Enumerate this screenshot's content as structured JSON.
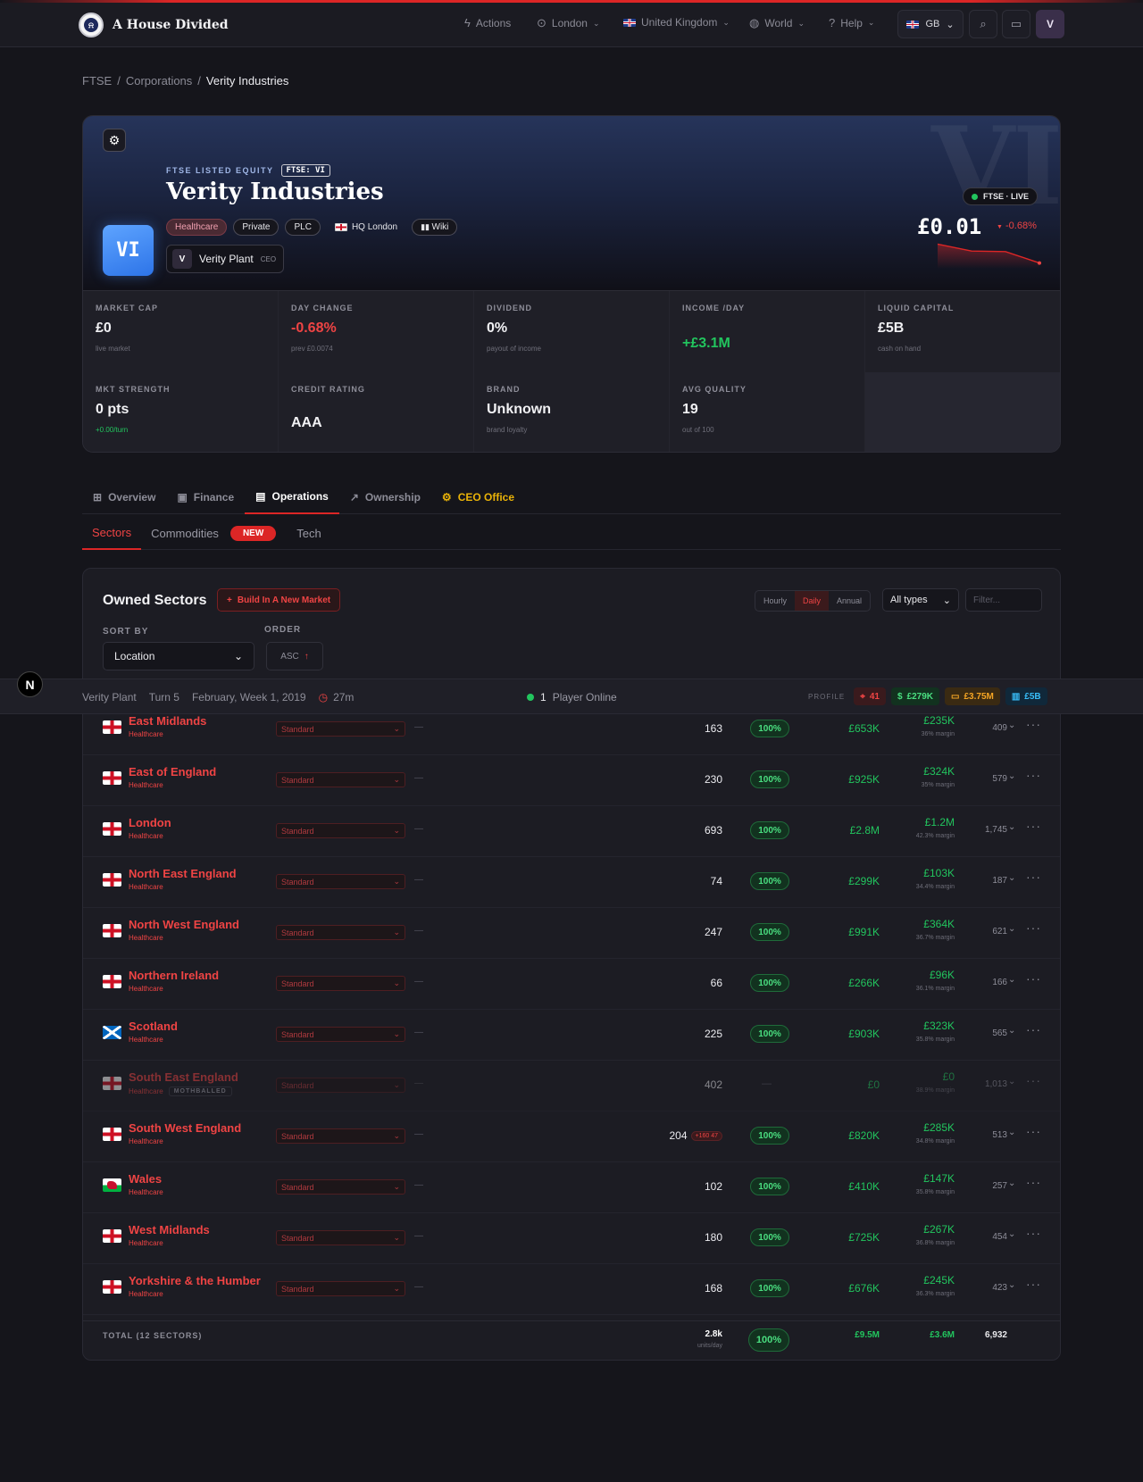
{
  "brand": {
    "name": "A House Divided"
  },
  "nav": {
    "actions": "Actions",
    "city": "London",
    "country": "United Kingdom",
    "world": "World",
    "help": "Help",
    "region": "GB",
    "avatar": "V"
  },
  "breadcrumb": {
    "root": "FTSE",
    "section": "Corporations",
    "current": "Verity Industries"
  },
  "hero": {
    "watermark": "VI",
    "logo": "VI",
    "listed_label": "FTSE LISTED EQUITY",
    "ticker": "FTSE: VI",
    "name": "Verity Industries",
    "chips": {
      "sector": "Healthcare",
      "ownership": "Private",
      "type": "PLC",
      "hq": "HQ London",
      "wiki": "Wiki"
    },
    "ceo": {
      "initial": "V",
      "name": "Verity Plant",
      "role": "CEO"
    },
    "live": "FTSE · LIVE",
    "price": "£0.01",
    "price_change": "-0.68%",
    "sparkline": [
      0.88,
      0.6,
      0.58,
      0.12
    ]
  },
  "stats": [
    {
      "label": "MARKET CAP",
      "value": "£0",
      "sub": "live market",
      "tone": ""
    },
    {
      "label": "DAY CHANGE",
      "value": "-0.68%",
      "sub": "prev £0.0074",
      "tone": "red"
    },
    {
      "label": "DIVIDEND",
      "value": "0%",
      "sub": "payout of income",
      "tone": ""
    },
    {
      "label": "INCOME /DAY",
      "value": "+£3.1M",
      "sub": "",
      "tone": "green"
    },
    {
      "label": "LIQUID CAPITAL",
      "value": "£5B",
      "sub": "cash on hand",
      "tone": ""
    },
    {
      "label": "MKT STRENGTH",
      "value": "0 pts",
      "sub": "+0.00/turn",
      "tone": "",
      "sub_tone": "green"
    },
    {
      "label": "CREDIT RATING",
      "value": "AAA",
      "sub": "",
      "tone": ""
    },
    {
      "label": "BRAND",
      "value": "Unknown",
      "sub": "brand loyalty",
      "tone": ""
    },
    {
      "label": "AVG QUALITY",
      "value": "19",
      "sub": "out of 100",
      "tone": ""
    }
  ],
  "tabs": {
    "overview": "Overview",
    "finance": "Finance",
    "operations": "Operations",
    "ownership": "Ownership",
    "ceo": "CEO Office"
  },
  "subtabs": {
    "sectors": "Sectors",
    "commodities": "Commodities",
    "new_badge": "NEW",
    "tech": "Tech"
  },
  "panel": {
    "title": "Owned Sectors",
    "build_button": "Build In A New Market",
    "period": {
      "hourly": "Hourly",
      "daily": "Daily",
      "annual": "Annual"
    },
    "types_select": "All types",
    "filter_placeholder": "Filter...",
    "sort_label": "SORT BY",
    "sort_value": "Location",
    "order_label": "ORDER",
    "order_value": "ASC"
  },
  "statusbar": {
    "player": "Verity Plant",
    "turn": "Turn 5",
    "date": "February, Week 1, 2019",
    "timer": "27m",
    "online_count": "1",
    "online_label": "Player Online",
    "profile_label": "PROFILE",
    "profile_points": "41",
    "profile_income": "£279K",
    "profile_wallet": "£3.75M",
    "profile_bank": "£5B"
  },
  "rows": [
    {
      "name": "East Midlands",
      "sector": "Healthcare",
      "flag": "eng",
      "quality": "Standard",
      "units": "163",
      "pct": "100%",
      "revenue": "£653K",
      "profit": "£235K",
      "margin": "36% margin",
      "count": "409"
    },
    {
      "name": "East of England",
      "sector": "Healthcare",
      "flag": "eng",
      "quality": "Standard",
      "units": "230",
      "pct": "100%",
      "revenue": "£925K",
      "profit": "£324K",
      "margin": "35% margin",
      "count": "579"
    },
    {
      "name": "London",
      "sector": "Healthcare",
      "flag": "eng",
      "quality": "Standard",
      "units": "693",
      "pct": "100%",
      "revenue": "£2.8M",
      "profit": "£1.2M",
      "margin": "42.3% margin",
      "count": "1,745"
    },
    {
      "name": "North East England",
      "sector": "Healthcare",
      "flag": "eng",
      "quality": "Standard",
      "units": "74",
      "pct": "100%",
      "revenue": "£299K",
      "profit": "£103K",
      "margin": "34.4% margin",
      "count": "187"
    },
    {
      "name": "North West England",
      "sector": "Healthcare",
      "flag": "eng",
      "quality": "Standard",
      "units": "247",
      "pct": "100%",
      "revenue": "£991K",
      "profit": "£364K",
      "margin": "36.7% margin",
      "count": "621"
    },
    {
      "name": "Northern Ireland",
      "sector": "Healthcare",
      "flag": "eng",
      "quality": "Standard",
      "units": "66",
      "pct": "100%",
      "revenue": "£266K",
      "profit": "£96K",
      "margin": "36.1% margin",
      "count": "166"
    },
    {
      "name": "Scotland",
      "sector": "Healthcare",
      "flag": "sco",
      "quality": "Standard",
      "units": "225",
      "pct": "100%",
      "revenue": "£903K",
      "profit": "£323K",
      "margin": "35.8% margin",
      "count": "565"
    },
    {
      "name": "South East England",
      "sector": "Healthcare",
      "flag": "eng",
      "quality": "Standard",
      "units": "402",
      "pct": "",
      "revenue": "£0",
      "profit": "£0",
      "margin": "38.9% margin",
      "count": "1,013",
      "mothballed": "MOTHBALLED"
    },
    {
      "name": "South West England",
      "sector": "Healthcare",
      "flag": "eng",
      "quality": "Standard",
      "units": "204",
      "upgrade": "+160 47",
      "pct": "100%",
      "revenue": "£820K",
      "profit": "£285K",
      "margin": "34.8% margin",
      "count": "513"
    },
    {
      "name": "Wales",
      "sector": "Healthcare",
      "flag": "wal",
      "quality": "Standard",
      "units": "102",
      "pct": "100%",
      "revenue": "£410K",
      "profit": "£147K",
      "margin": "35.8% margin",
      "count": "257"
    },
    {
      "name": "West Midlands",
      "sector": "Healthcare",
      "flag": "eng",
      "quality": "Standard",
      "units": "180",
      "pct": "100%",
      "revenue": "£725K",
      "profit": "£267K",
      "margin": "36.8% margin",
      "count": "454"
    },
    {
      "name": "Yorkshire & the Humber",
      "sector": "Healthcare",
      "flag": "eng",
      "quality": "Standard",
      "units": "168",
      "pct": "100%",
      "revenue": "£676K",
      "profit": "£245K",
      "margin": "36.3% margin",
      "count": "423"
    }
  ],
  "totals": {
    "label": "TOTAL (12 SECTORS)",
    "units": "2.8k",
    "units_sub": "units/day",
    "pct": "100%",
    "revenue": "£9.5M",
    "profit": "£3.6M",
    "count": "6,932"
  },
  "colors": {
    "accent": "#dc2626",
    "positive": "#22c55e",
    "brand_blue": "#2d74e8"
  }
}
